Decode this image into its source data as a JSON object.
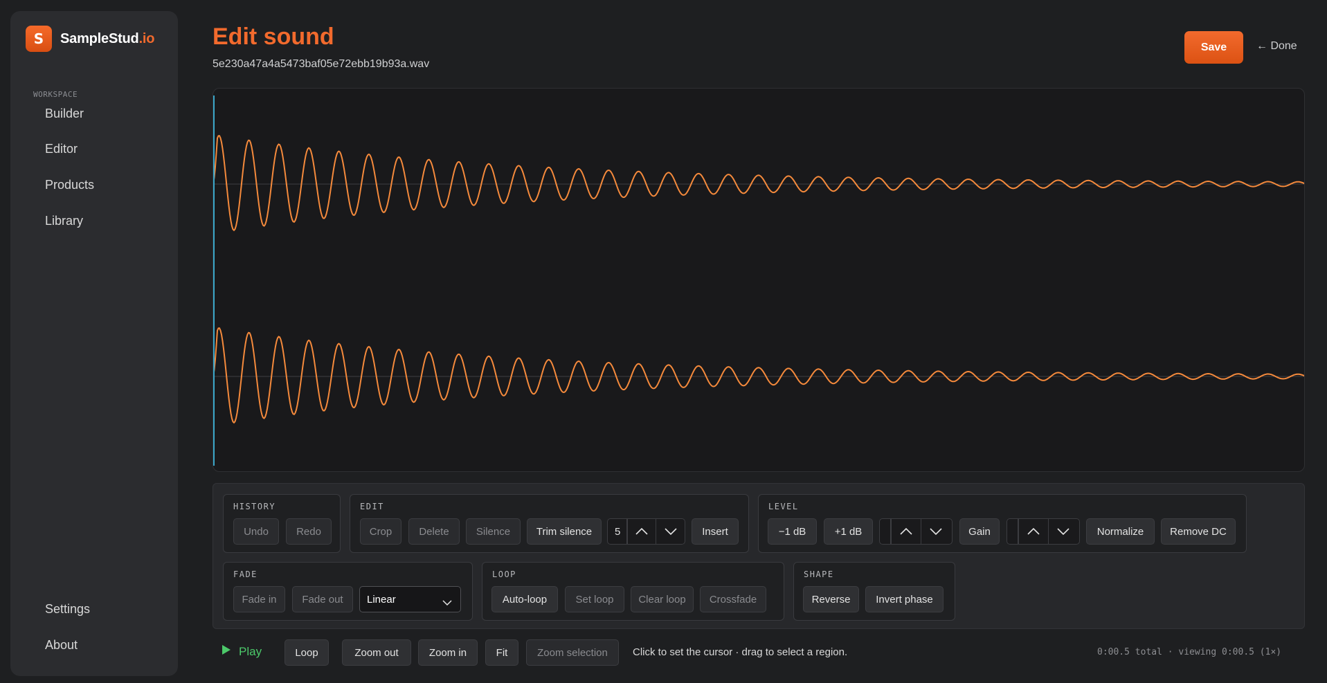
{
  "brand": {
    "logo_letter": "S",
    "name": "SampleStud",
    "name_accent": ".io",
    "color": "#f26a2d"
  },
  "sidebar": {
    "section_label": "WORKSPACE",
    "items": [
      {
        "label": "Builder"
      },
      {
        "label": "Editor"
      },
      {
        "label": "Products"
      },
      {
        "label": "Library"
      }
    ],
    "bottom_items": [
      {
        "label": "Settings"
      },
      {
        "label": "About"
      }
    ]
  },
  "header": {
    "title": "Edit sound",
    "file_name": "5e230a47a4a5473baf05e72ebb19b93a.wav",
    "save_label": "Save",
    "done_label": "← Done"
  },
  "waveform": {
    "channels": 2,
    "color": "#f58a3c",
    "cursor_color": "#3aa6c9"
  },
  "controls": {
    "history": {
      "title": "HISTORY",
      "undo": "Undo",
      "redo": "Redo"
    },
    "edit": {
      "title": "EDIT",
      "crop": "Crop",
      "delete": "Delete",
      "silence": "Silence",
      "trim_silence": "Trim silence",
      "stepper_value": "5",
      "insert": "Insert"
    },
    "level": {
      "title": "LEVEL",
      "minus_db": "−1 dB",
      "plus_db": "+1 dB",
      "gain": "Gain",
      "normalize": "Normalize",
      "remove_dc": "Remove DC"
    },
    "fade": {
      "title": "FADE",
      "fade_in": "Fade in",
      "fade_out": "Fade out",
      "curve": "Linear"
    },
    "loop": {
      "title": "LOOP",
      "auto_loop": "Auto-loop",
      "set_loop": "Set loop",
      "clear_loop": "Clear loop",
      "crossfade": "Crossfade"
    },
    "shape": {
      "title": "SHAPE",
      "reverse": "Reverse",
      "invert_phase": "Invert phase"
    }
  },
  "footer": {
    "play": "Play",
    "loop": "Loop",
    "zoom_out": "Zoom out",
    "zoom_in": "Zoom in",
    "fit": "Fit",
    "zoom_selection": "Zoom selection",
    "hint": "Click to set the cursor · drag to select a region.",
    "status": "0:00.5 total · viewing 0:00.5 (1×)"
  }
}
